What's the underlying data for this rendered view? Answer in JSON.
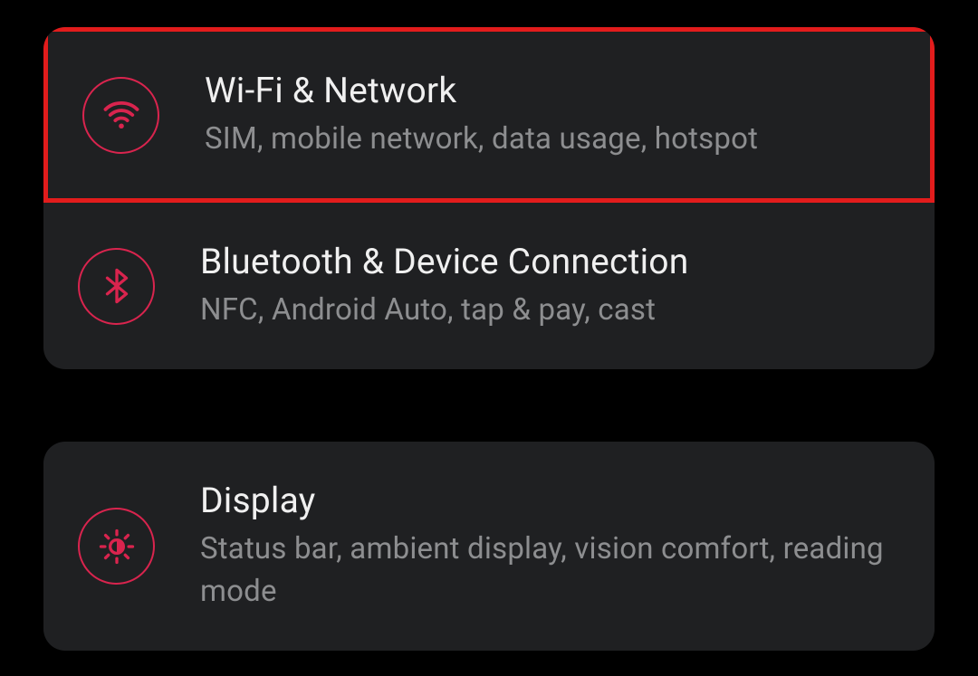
{
  "settings": {
    "groups": [
      {
        "items": [
          {
            "id": "wifi-network",
            "title": "Wi-Fi & Network",
            "subtitle": "SIM, mobile network, data usage, hotspot",
            "highlighted": true
          },
          {
            "id": "bluetooth-device",
            "title": "Bluetooth & Device Connection",
            "subtitle": "NFC, Android Auto, tap & pay, cast",
            "highlighted": false
          }
        ]
      },
      {
        "items": [
          {
            "id": "display",
            "title": "Display",
            "subtitle": "Status bar, ambient display, vision comfort, reading mode",
            "highlighted": false
          }
        ]
      }
    ]
  },
  "colors": {
    "accent": "#d9244e",
    "highlight": "#e21c1c",
    "background": "#000000",
    "card": "#1f2022",
    "text_primary": "#f0f0f0",
    "text_secondary": "#8d8e90"
  }
}
